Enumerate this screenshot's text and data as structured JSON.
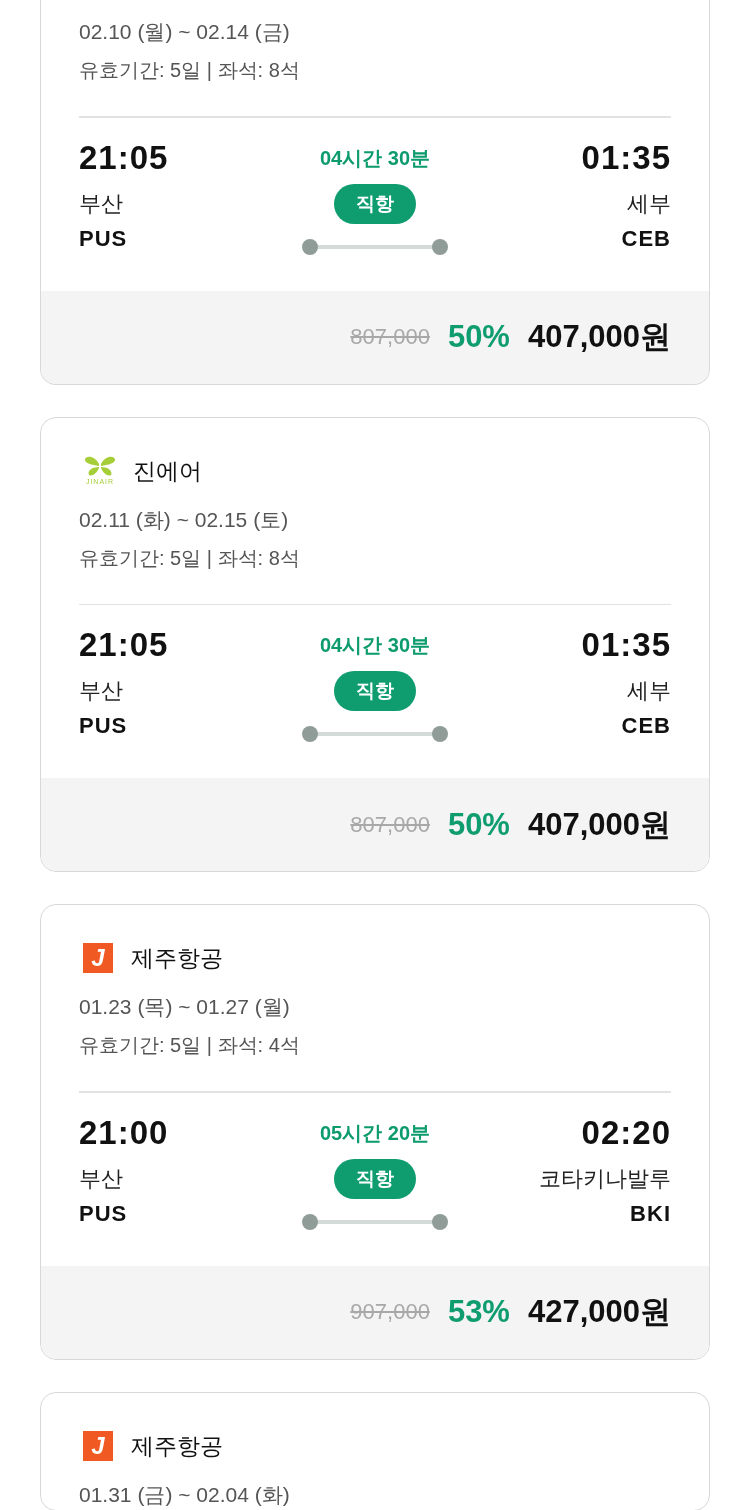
{
  "flights": [
    {
      "dates": "02.10 (월) ~ 02.14 (금)",
      "validity": "유효기간: 5일 | 좌석: 8석",
      "departure": {
        "time": "21:05",
        "city": "부산",
        "code": "PUS"
      },
      "duration": "04시간 30분",
      "flight_type": "직항",
      "arrival": {
        "time": "01:35",
        "city": "세부",
        "code": "CEB"
      },
      "price": {
        "original": "807,000",
        "discount": "50%",
        "final": "407,000원"
      }
    },
    {
      "airline": {
        "name": "진에어",
        "logo": {
          "kind": "butterfly",
          "text": "JINAIR"
        }
      },
      "dates": "02.11 (화) ~ 02.15 (토)",
      "validity": "유효기간: 5일 | 좌석: 8석",
      "departure": {
        "time": "21:05",
        "city": "부산",
        "code": "PUS"
      },
      "duration": "04시간 30분",
      "flight_type": "직항",
      "arrival": {
        "time": "01:35",
        "city": "세부",
        "code": "CEB"
      },
      "price": {
        "original": "807,000",
        "discount": "50%",
        "final": "407,000원"
      }
    },
    {
      "airline": {
        "name": "제주항공",
        "logo": {
          "kind": "tile",
          "text": "J"
        }
      },
      "dates": "01.23 (목) ~ 01.27 (월)",
      "validity": "유효기간: 5일 | 좌석: 4석",
      "departure": {
        "time": "21:00",
        "city": "부산",
        "code": "PUS"
      },
      "duration": "05시간 20분",
      "flight_type": "직항",
      "arrival": {
        "time": "02:20",
        "city": "코타키나발루",
        "code": "BKI"
      },
      "price": {
        "original": "907,000",
        "discount": "53%",
        "final": "427,000원"
      }
    },
    {
      "airline": {
        "name": "제주항공",
        "logo": {
          "kind": "tile",
          "text": "J"
        }
      },
      "dates": "01.31 (금) ~ 02.04 (화)"
    }
  ]
}
